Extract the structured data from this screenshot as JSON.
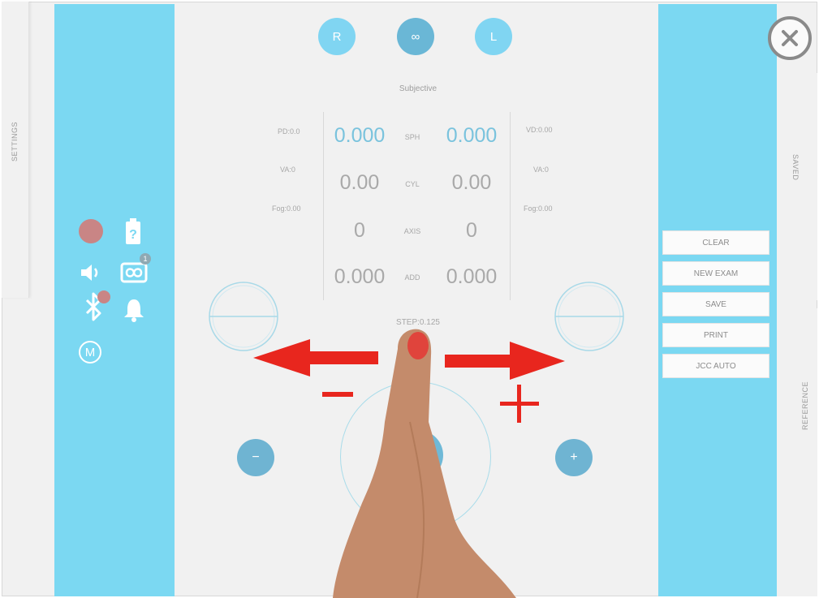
{
  "tabs": {
    "settings": "SETTINGS",
    "saved": "SAVED",
    "reference": "REFERENCE"
  },
  "eye_selector": [
    {
      "label": "R"
    },
    {
      "label": "∞"
    },
    {
      "label": "L"
    }
  ],
  "mode_title": "Subjective",
  "left_info": {
    "pd": "PD:0.0",
    "va": "VA:0",
    "fog": "Fog:0.00"
  },
  "right_info": {
    "vd": "VD:0.00",
    "va": "VA:0",
    "fog": "Fog:0.00"
  },
  "rows": [
    {
      "label": "SPH",
      "right_eye": "0.000",
      "left_eye": "0.000"
    },
    {
      "label": "CYL",
      "right_eye": "0.00",
      "left_eye": "0.00"
    },
    {
      "label": "AXIS",
      "right_eye": "0",
      "left_eye": "0"
    },
    {
      "label": "ADD",
      "right_eye": "0.000",
      "left_eye": "0.000"
    }
  ],
  "step": "STEP:0.125",
  "controls": {
    "minus": "−",
    "plus": "+"
  },
  "actions": {
    "clear": "CLEAR",
    "new_exam": "NEW EXAM",
    "save": "SAVE",
    "print": "PRINT",
    "jcc_auto": "JCC AUTO"
  },
  "status_icons": {
    "record": "record-dot-icon",
    "battery": "battery-unknown-icon",
    "volume": "volume-icon",
    "link": "infinity-link-icon",
    "link_badge": "1",
    "bluetooth": "bluetooth-icon",
    "bell": "bell-icon",
    "m_badge": "M"
  },
  "colors": {
    "panel": "#7bd8f2",
    "accent": "#6fb4d2",
    "record": "#c98585",
    "annotation": "#e8261e"
  }
}
